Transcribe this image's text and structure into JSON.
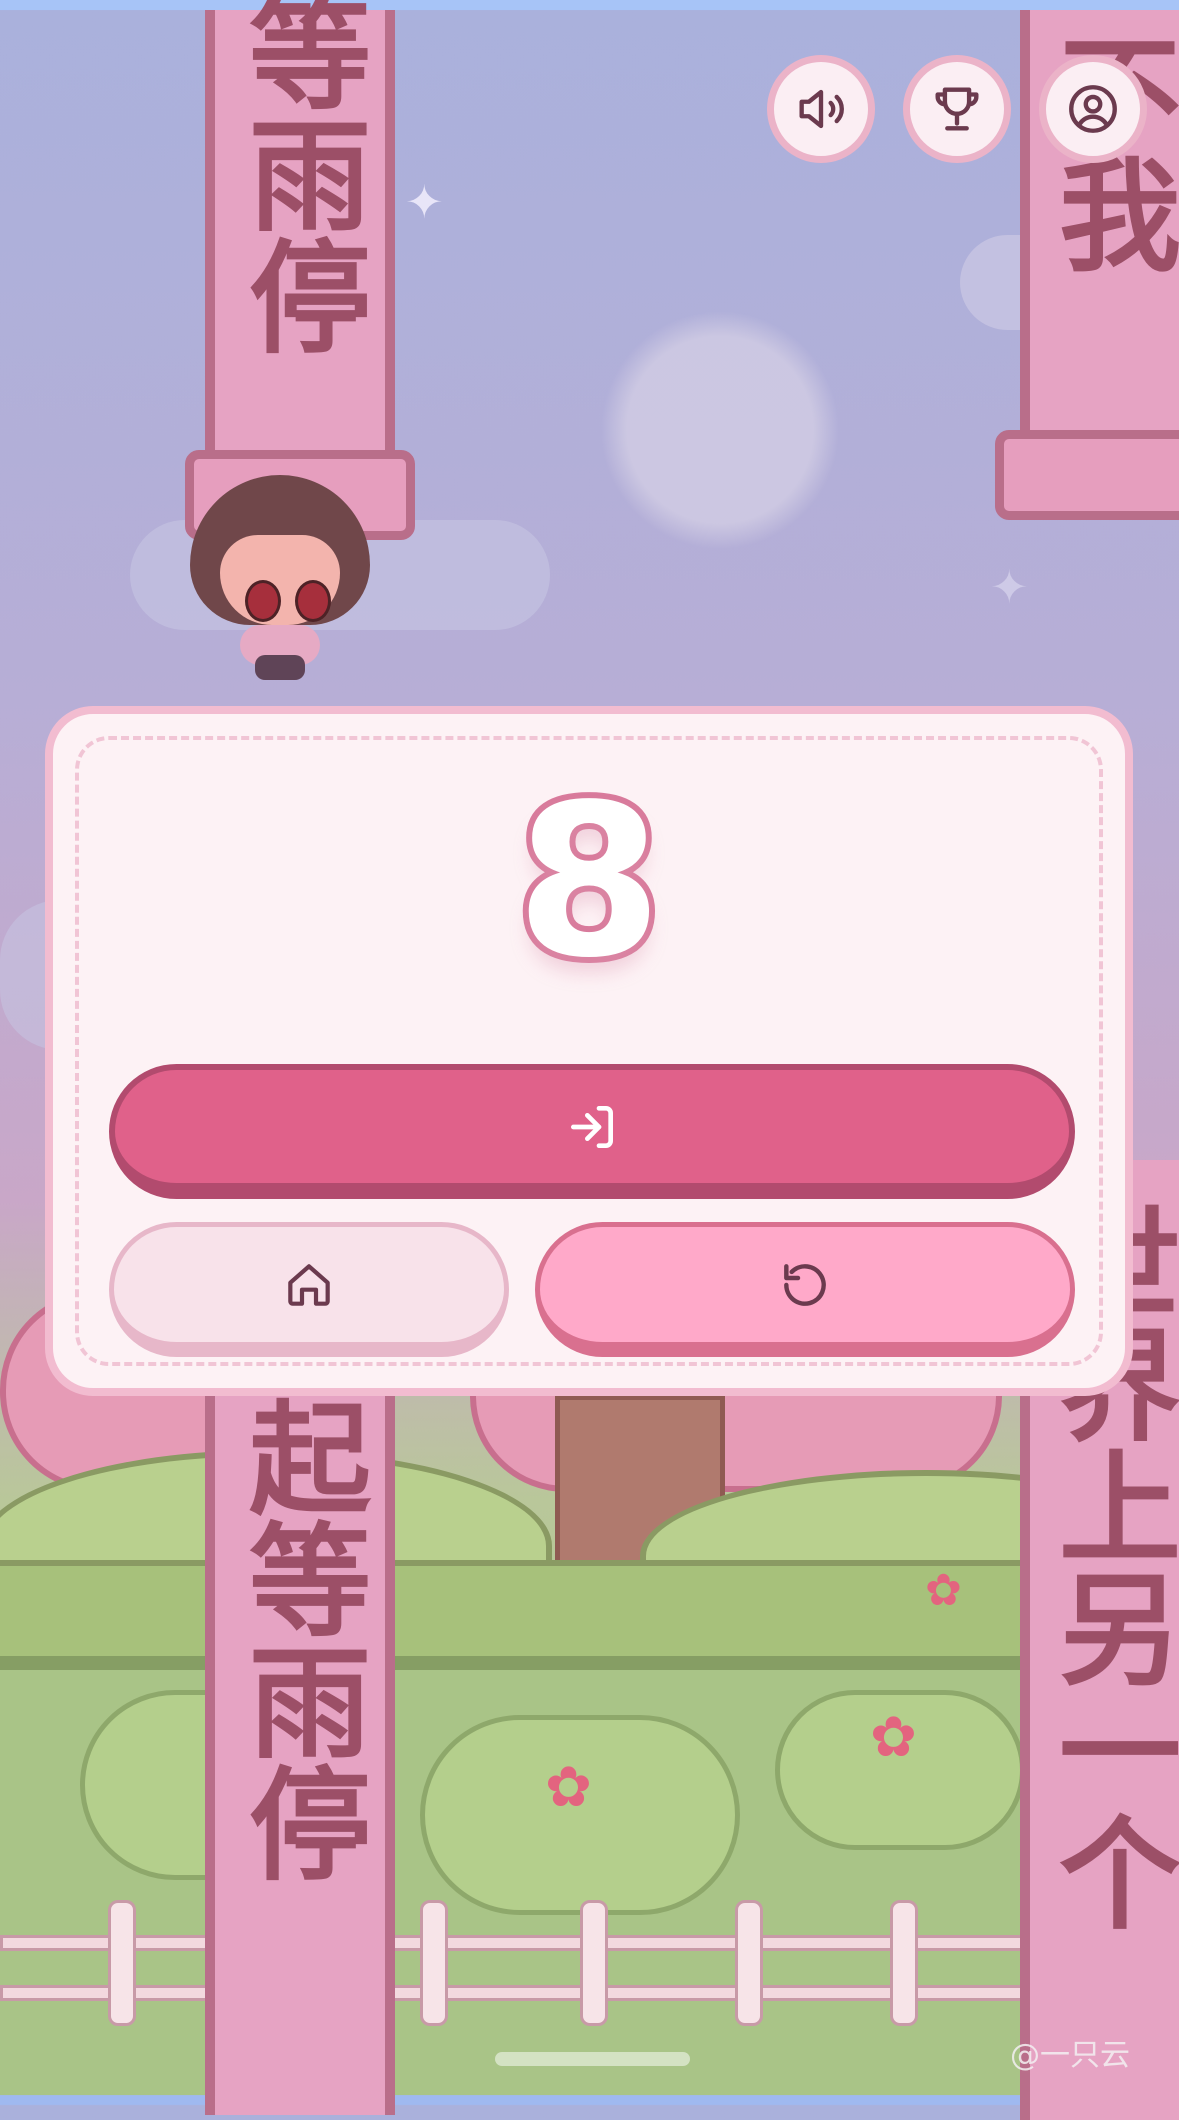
{
  "game": {
    "score": "8",
    "pillars": {
      "top_left_text": "等雨停",
      "top_right_text": "不我",
      "bottom_left_text": "起等雨停",
      "bottom_right_text": "世界上另一个"
    }
  },
  "top_controls": [
    {
      "icon": "speaker-icon"
    },
    {
      "icon": "trophy-icon"
    },
    {
      "icon": "user-icon"
    }
  ],
  "panel": {
    "primary_icon": "login-icon",
    "home_icon": "home-icon",
    "retry_icon": "restart-icon"
  },
  "watermark": "@一只云",
  "colors": {
    "panel_bg": "#fdf2f5",
    "panel_border": "#f2bcd0",
    "primary_button": "#e0618a",
    "retry_button": "#ffa9c9",
    "home_button": "#f8e2ea",
    "score_stroke": "#d97b9c",
    "icon_stroke": "#6b3a4e"
  }
}
